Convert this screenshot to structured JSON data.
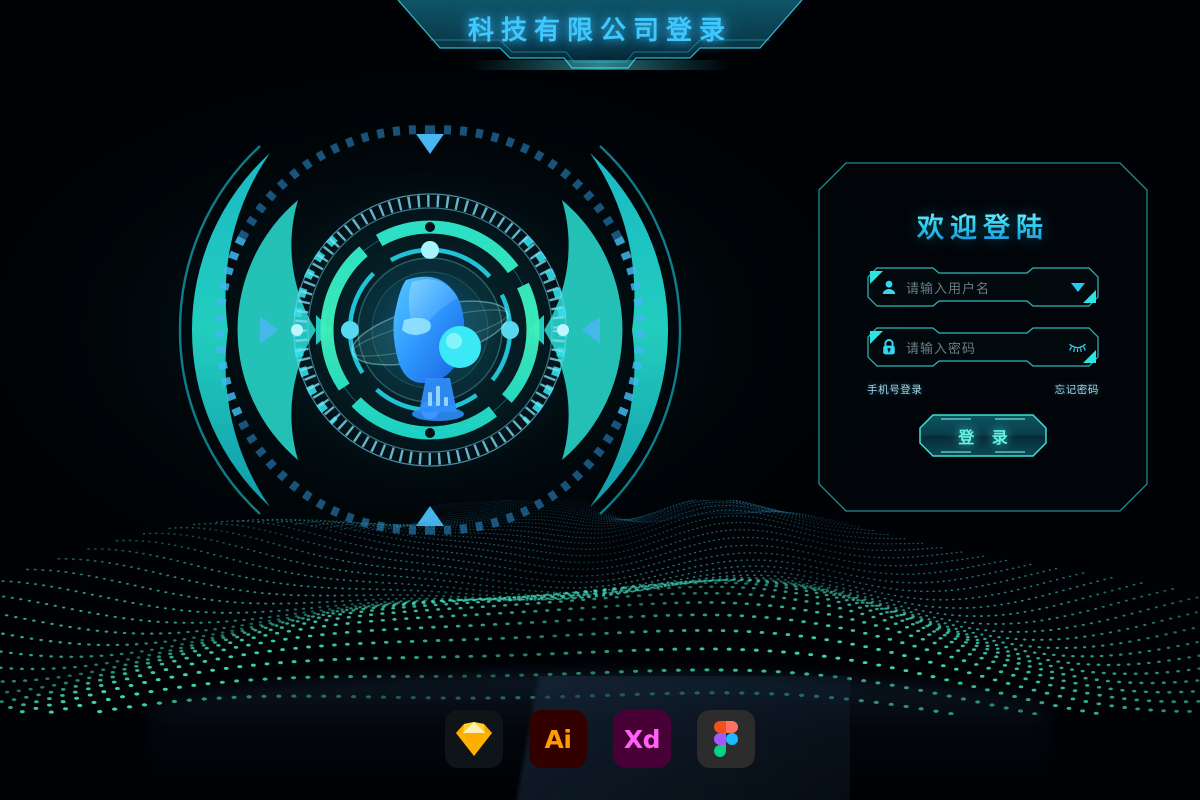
{
  "header": {
    "title": "科技有限公司登录",
    "banner_fill_top": "#0d4c5e",
    "banner_fill_bottom": "#07252f",
    "banner_stroke": "#35cfe0",
    "title_color": "#3ec8ff"
  },
  "panel": {
    "title": "欢迎登陆",
    "border_color": "#1d8d8f",
    "accent_color": "#31e3e0",
    "fields": [
      {
        "name": "username",
        "icon": "user-icon",
        "placeholder": "请输入用户名",
        "value": "",
        "trailing_icon": "chevron-down-icon"
      },
      {
        "name": "password",
        "icon": "lock-icon",
        "placeholder": "请输入密码",
        "value": "",
        "trailing_icon": "eye-closed-icon"
      }
    ],
    "links": [
      {
        "label": "手机号登录",
        "name": "phone-login-link"
      },
      {
        "label": "忘记密码",
        "name": "forgot-password-link"
      }
    ],
    "submit": {
      "label": "登 录",
      "text_color": "#63f2e4"
    }
  },
  "hud": {
    "center_graphic": "robot-head-icon",
    "robot_color": "#2aa8ff",
    "ring_color_outer": "#1fe3d6",
    "ring_color_inner": "#2ff0c0",
    "tick_color": "#3fb8ef",
    "marker_icon": "triangle-marker-icon"
  },
  "terrain": {
    "front_color": "#3fe0c4",
    "back_color": "#2a6fa8",
    "description": "particle-wave-landscape"
  },
  "footer": {
    "logos": [
      {
        "name": "sketch-logo",
        "label": "",
        "bg": "#0e1417"
      },
      {
        "name": "illustrator-logo",
        "label": "Ai",
        "bg": "#330000",
        "fg": "#ff9a00"
      },
      {
        "name": "adobe-xd-logo",
        "label": "Xd",
        "bg": "#470137",
        "fg": "#ff61f6"
      },
      {
        "name": "figma-logo",
        "label": "",
        "bg": "#2c2c2c"
      }
    ]
  }
}
